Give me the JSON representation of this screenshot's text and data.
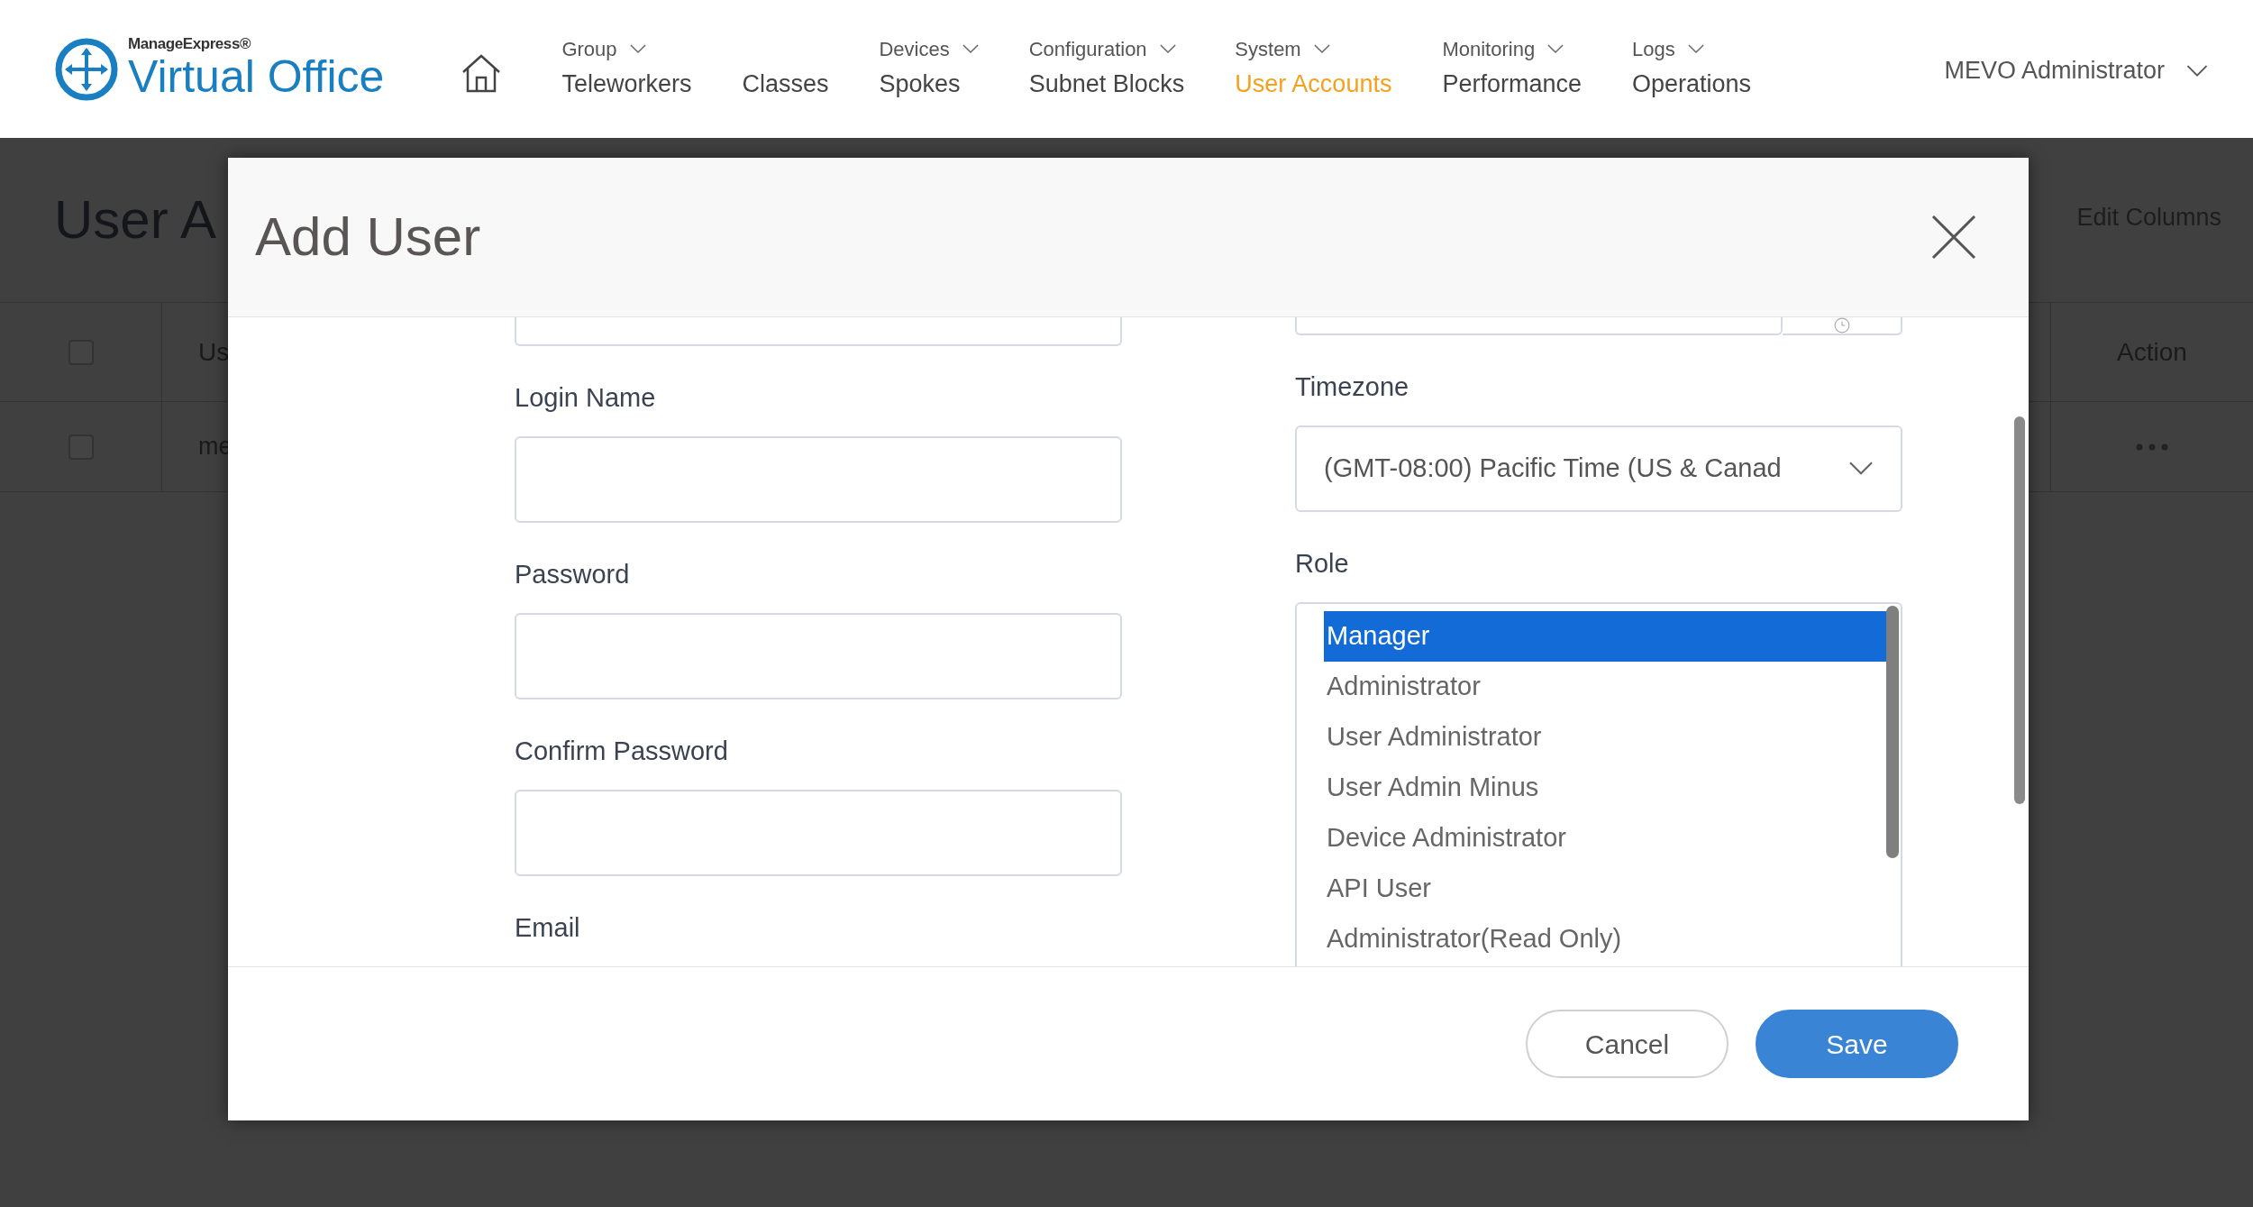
{
  "header": {
    "brand": "ManageExpress®",
    "product": "Virtual Office",
    "nav": [
      {
        "category": "Group",
        "label": "Teleworkers",
        "selected": false
      },
      {
        "label": "Classes",
        "selected": false
      },
      {
        "category": "Devices",
        "label": "Spokes",
        "selected": false
      },
      {
        "category": "Configuration",
        "label": "Subnet Blocks",
        "selected": false
      },
      {
        "category": "System",
        "label": "User Accounts",
        "selected": true
      },
      {
        "category": "Monitoring",
        "label": "Performance",
        "selected": false
      },
      {
        "category": "Logs",
        "label": "Operations",
        "selected": false
      }
    ],
    "user_menu": "MEVO Administrator"
  },
  "page": {
    "title": "User A",
    "edit_columns": "Edit Columns",
    "table": {
      "columns": [
        "Us",
        "Action"
      ],
      "rows": [
        {
          "checked": false,
          "column_1": "me"
        }
      ],
      "header_checked": false
    }
  },
  "dialog": {
    "title": "Add User",
    "left_fields": [
      {
        "label": "Login Name"
      },
      {
        "label": "Password"
      },
      {
        "label": "Confirm Password"
      }
    ],
    "email_label": "Email",
    "timezone": {
      "label": "Timezone",
      "value": "(GMT-08:00) Pacific Time (US & Canad"
    },
    "role": {
      "label": "Role",
      "options": [
        {
          "label": "Manager",
          "selected": true
        },
        {
          "label": "Administrator",
          "selected": false
        },
        {
          "label": "User Administrator",
          "selected": false
        },
        {
          "label": "User Admin Minus",
          "selected": false
        },
        {
          "label": "Device Administrator",
          "selected": false
        },
        {
          "label": "API User",
          "selected": false
        },
        {
          "label": "Administrator(Read Only)",
          "selected": false
        }
      ]
    },
    "buttons": [
      {
        "kind": "secondary",
        "label": "Cancel"
      },
      {
        "kind": "primary",
        "label": "Save"
      }
    ]
  }
}
